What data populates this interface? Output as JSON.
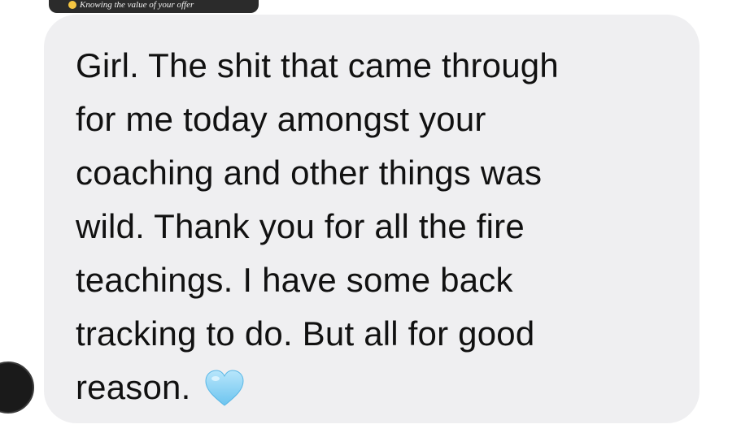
{
  "quoted_story": {
    "label": "Knowing the value of your offer",
    "emoji_icon": "smiling-face-emoji-icon"
  },
  "message": {
    "lines": [
      "Girl. The shit that came through",
      "for me today amongst your",
      "coaching and other things was",
      "wild. Thank you for all the fire",
      "teachings. I have some back",
      "tracking to do. But all for good",
      "reason."
    ],
    "emoji_icon": "light-blue-heart-icon"
  },
  "colors": {
    "bubble": "#efeff1",
    "text": "#111111",
    "heart": "#8fd3f4"
  }
}
